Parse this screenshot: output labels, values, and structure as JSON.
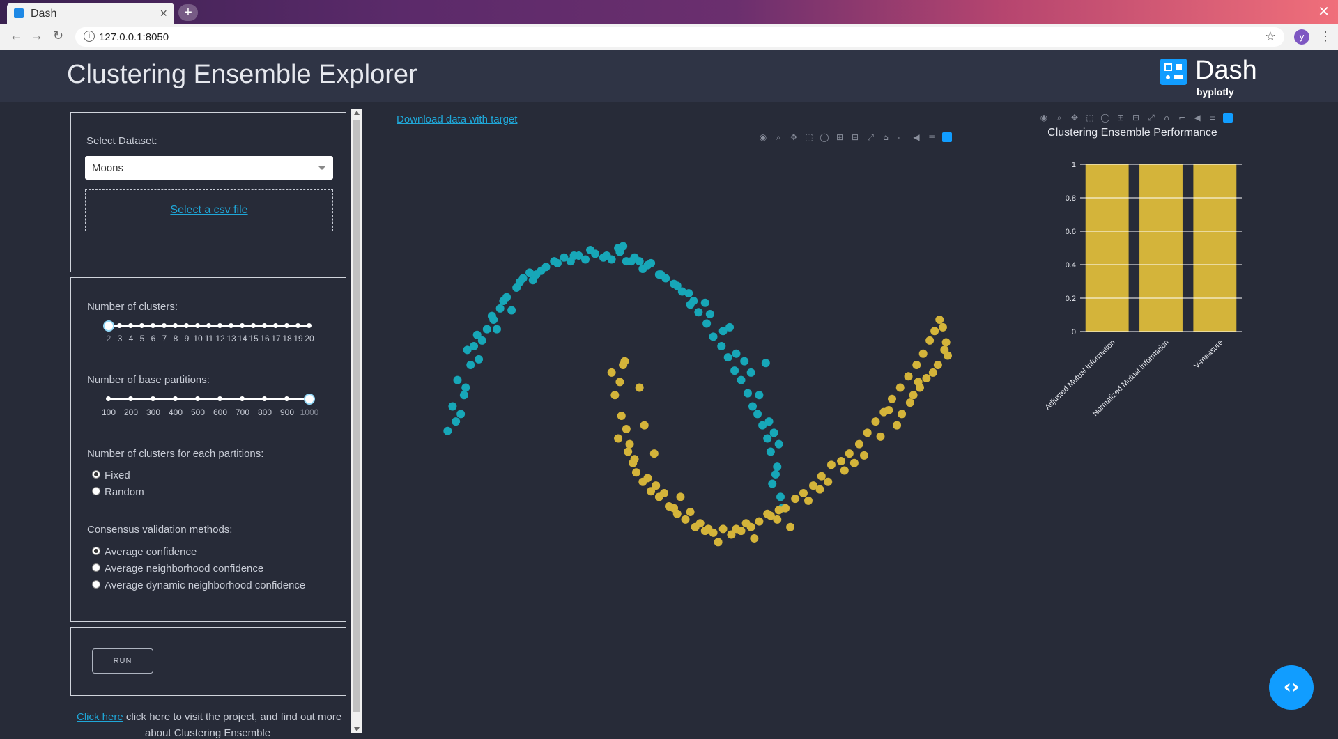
{
  "browser": {
    "tab_title": "Dash",
    "url": "127.0.0.1:8050",
    "avatar_letter": "y"
  },
  "header": {
    "title": "Clustering Ensemble Explorer",
    "logo_word": "Dash",
    "logo_by": "byplotly"
  },
  "dataset_panel": {
    "label": "Select Dataset:",
    "selected": "Moons",
    "upload_link": "Select a csv file"
  },
  "params_panel": {
    "clusters_label": "Number of clusters:",
    "clusters_ticks": [
      "2",
      "3",
      "4",
      "5",
      "6",
      "7",
      "8",
      "9",
      "10",
      "11",
      "12",
      "13",
      "14",
      "15",
      "16",
      "17",
      "18",
      "19",
      "20"
    ],
    "clusters_value": 2,
    "partitions_label": "Number of base partitions:",
    "partitions_ticks": [
      "100",
      "200",
      "300",
      "400",
      "500",
      "600",
      "700",
      "800",
      "900",
      "1000"
    ],
    "partitions_value": 1000,
    "each_label": "Number of clusters for each partitions:",
    "each_options": [
      {
        "label": "Fixed",
        "checked": true
      },
      {
        "label": "Random",
        "checked": false
      }
    ],
    "consensus_label": "Consensus validation methods:",
    "consensus_options": [
      {
        "label": "Average confidence",
        "checked": true
      },
      {
        "label": "Average neighborhood confidence",
        "checked": false
      },
      {
        "label": "Average dynamic neighborhood confidence",
        "checked": false
      }
    ]
  },
  "run_panel": {
    "run_label": "RUN"
  },
  "footer": {
    "link": "Click here",
    "text": " click here to visit the project, and find out more",
    "text2": "about Clustering Ensemble"
  },
  "main": {
    "download_link": "Download data with target"
  },
  "colors": {
    "cluster_a": "#17a7b8",
    "cluster_b": "#d4b43a",
    "background": "#272b38",
    "accent": "#119dff"
  },
  "modebar_icons": [
    "camera-icon",
    "zoom-icon",
    "pan-icon",
    "box-select-icon",
    "lasso-icon",
    "zoom-in-icon",
    "zoom-out-icon",
    "autoscale-icon",
    "reset-axes-icon",
    "spike-lines-icon",
    "hover-closest-icon",
    "hover-compare-icon",
    "plotly-logo-icon"
  ],
  "chart_data": [
    {
      "type": "scatter",
      "title": "",
      "xlabel": "",
      "ylabel": "",
      "grid": false,
      "xlim": [
        -1.2,
        2.2
      ],
      "ylim": [
        -0.6,
        1.1
      ],
      "series": [
        {
          "color": "#17a7b8",
          "x": [
            -1.02,
            -0.97,
            -0.99,
            -0.94,
            -0.96,
            -0.91,
            -0.88,
            -0.86,
            -0.9,
            -0.84,
            -0.81,
            -0.78,
            -0.74,
            -0.7,
            -0.66,
            -0.6,
            -0.56,
            -0.52,
            -0.48,
            -0.42,
            -0.37,
            -0.31,
            -0.27,
            -0.22,
            -0.18,
            -0.12,
            -0.07,
            -0.02,
            0.03,
            0.07,
            0.12,
            0.17,
            0.22,
            0.27,
            0.31,
            0.36,
            0.41,
            0.46,
            0.51,
            0.56,
            0.6,
            0.65,
            0.69,
            0.73,
            0.77,
            0.81,
            0.84,
            0.87,
            0.9,
            0.93,
            0.95,
            0.97,
            0.99,
            1.0,
            0.98,
            1.01,
            0.96,
            1.02,
            0.92,
            -0.75,
            -0.68,
            -0.58,
            -0.5,
            -0.45,
            -0.35,
            -0.25,
            -0.15,
            -0.05,
            0.02,
            0.1,
            0.2,
            0.28,
            0.38,
            0.48,
            0.58,
            0.66,
            0.74,
            0.83,
            0.88,
            0.94,
            -0.92,
            -0.83,
            -0.72,
            -0.63,
            0.05,
            0.15,
            0.45,
            0.55,
            0.7,
            0.79
          ],
          "y": [
            0.07,
            0.12,
            0.2,
            0.16,
            0.34,
            0.3,
            0.42,
            0.52,
            0.5,
            0.58,
            0.55,
            0.61,
            0.66,
            0.72,
            0.78,
            0.83,
            0.88,
            0.91,
            0.9,
            0.94,
            0.97,
            0.99,
            0.97,
            1.0,
            0.98,
            1.01,
            0.99,
            0.98,
            1.02,
            0.97,
            0.99,
            0.93,
            0.96,
            0.9,
            0.88,
            0.85,
            0.81,
            0.74,
            0.7,
            0.64,
            0.57,
            0.52,
            0.46,
            0.39,
            0.34,
            0.27,
            0.2,
            0.16,
            0.1,
            0.03,
            -0.04,
            0.06,
            -0.12,
            0.0,
            -0.16,
            -0.28,
            -0.21,
            -0.34,
            0.43,
            0.68,
            0.76,
            0.86,
            0.87,
            0.92,
            0.96,
            1.0,
            1.03,
            1.0,
            1.04,
            0.97,
            0.95,
            0.9,
            0.84,
            0.76,
            0.69,
            0.6,
            0.48,
            0.38,
            0.26,
            0.12,
            0.26,
            0.45,
            0.61,
            0.71,
            1.05,
            0.97,
            0.8,
            0.75,
            0.62,
            0.44
          ]
        },
        {
          "color": "#d4b43a",
          "x": [
            -0.02,
            0.03,
            0.05,
            0.0,
            0.04,
            0.07,
            0.02,
            0.08,
            0.11,
            0.09,
            0.13,
            0.17,
            0.22,
            0.27,
            0.33,
            0.38,
            0.43,
            0.49,
            0.55,
            0.6,
            0.66,
            0.71,
            0.77,
            0.83,
            0.88,
            0.93,
            0.99,
            1.04,
            1.1,
            1.15,
            1.21,
            1.26,
            1.32,
            1.38,
            1.43,
            1.49,
            1.54,
            1.59,
            1.64,
            1.69,
            1.74,
            1.79,
            1.84,
            1.88,
            1.92,
            1.95,
            1.98,
            2.0,
            2.02,
            2.03,
            1.97,
            1.9,
            1.86,
            1.8,
            1.75,
            0.12,
            0.2,
            0.25,
            0.3,
            0.36,
            0.46,
            0.52,
            0.63,
            0.74,
            0.85,
            0.95,
            1.07,
            1.18,
            1.3,
            1.4,
            1.52,
            1.62,
            1.72,
            1.82,
            1.94,
            2.01,
            0.06,
            0.15,
            0.18,
            0.24,
            0.4,
            0.57,
            0.8,
            1.0,
            1.25,
            1.46,
            1.67,
            1.85
          ],
          "y": [
            0.38,
            0.33,
            0.42,
            0.26,
            0.15,
            0.08,
            0.03,
            -0.04,
            -0.1,
            0.0,
            -0.15,
            -0.2,
            -0.25,
            -0.28,
            -0.33,
            -0.37,
            -0.4,
            -0.44,
            -0.46,
            -0.47,
            -0.45,
            -0.48,
            -0.46,
            -0.44,
            -0.41,
            -0.37,
            -0.4,
            -0.34,
            -0.29,
            -0.26,
            -0.22,
            -0.17,
            -0.11,
            -0.09,
            -0.05,
            0.0,
            0.06,
            0.12,
            0.17,
            0.24,
            0.3,
            0.36,
            0.42,
            0.48,
            0.55,
            0.6,
            0.66,
            0.62,
            0.54,
            0.47,
            0.42,
            0.35,
            0.3,
            0.22,
            0.16,
            -0.08,
            -0.18,
            -0.22,
            -0.26,
            -0.34,
            -0.36,
            -0.42,
            -0.52,
            -0.45,
            -0.5,
            -0.38,
            -0.44,
            -0.3,
            -0.2,
            -0.14,
            -0.06,
            0.04,
            0.1,
            0.26,
            0.38,
            0.5,
            0.44,
            0.3,
            0.1,
            -0.05,
            -0.28,
            -0.45,
            -0.42,
            -0.35,
            -0.24,
            -0.1,
            0.18,
            0.33
          ]
        }
      ]
    },
    {
      "type": "bar",
      "title": "Clustering Ensemble Performance",
      "categories": [
        "Adjusted Mutual Information",
        "Normalized Mutual Information",
        "V-measure"
      ],
      "values": [
        1,
        1,
        1
      ],
      "color": "#d4b43a",
      "ylim": [
        0,
        1
      ],
      "yticks": [
        "0",
        "0.2",
        "0.4",
        "0.6",
        "0.8",
        "1"
      ],
      "grid": true
    }
  ]
}
